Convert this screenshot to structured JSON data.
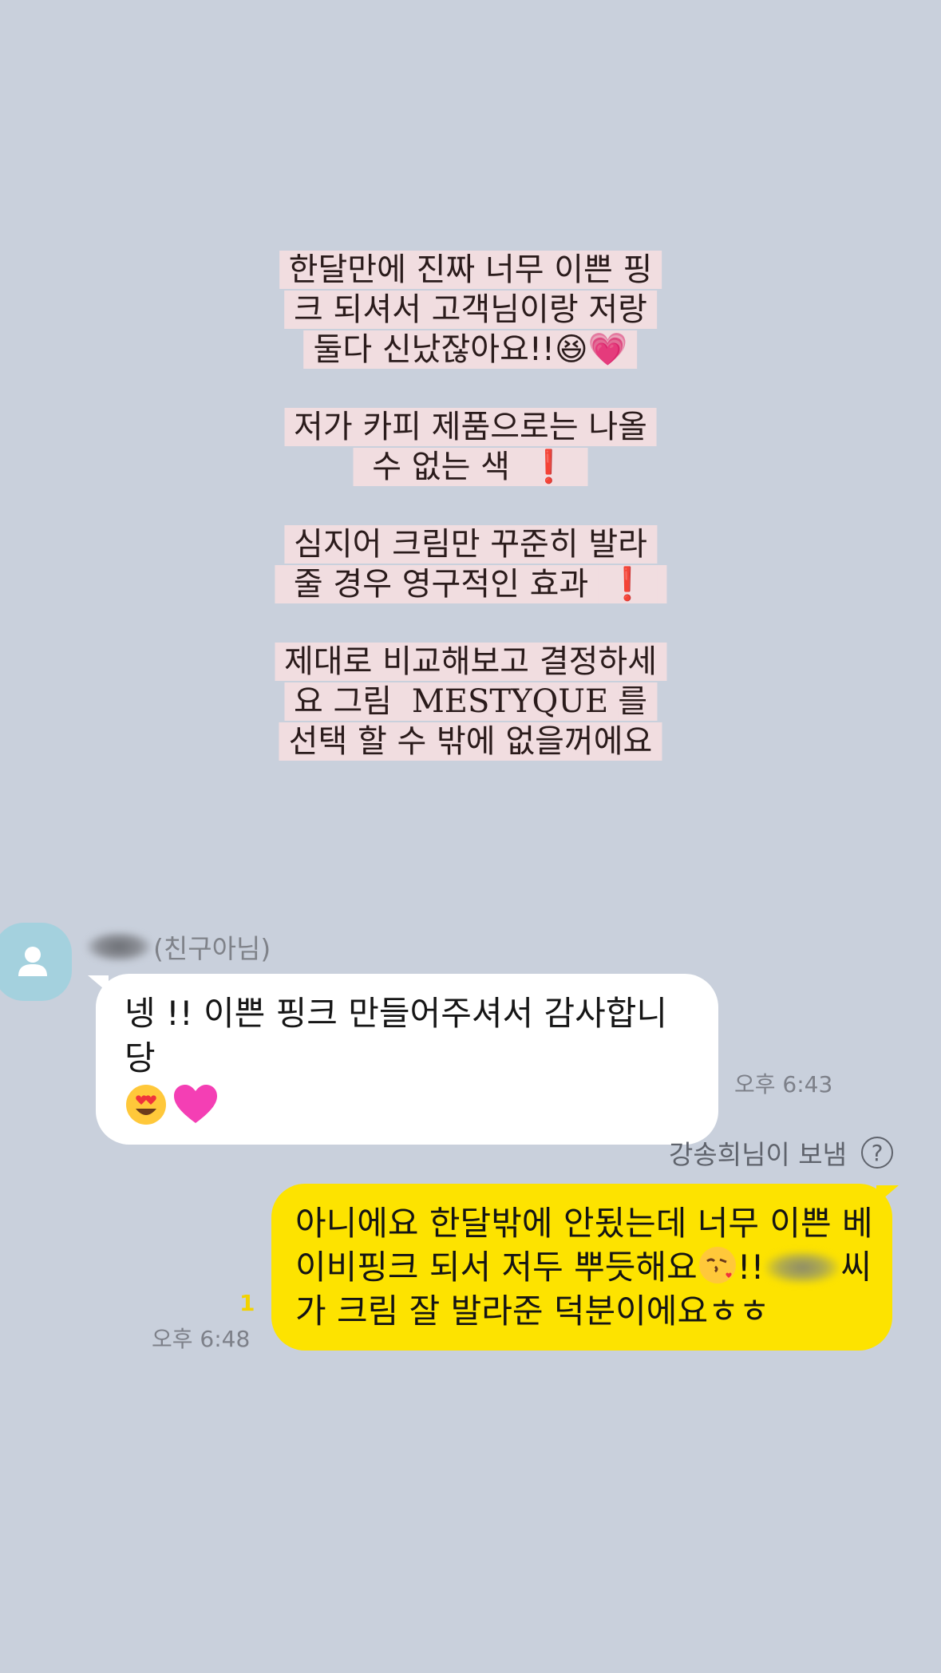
{
  "captions": [
    {
      "lines": [
        "한달만에 진짜 너무 이쁜 핑",
        "크 되셔서 고객님이랑 저랑",
        "둘다 신났잖아요!!😆💗"
      ]
    },
    {
      "lines": [
        "저가 카피 제품으로는 나올",
        "수 없는 색"
      ],
      "mark": "❗"
    },
    {
      "lines": [
        "심지어 크림만 꾸준히 발라",
        "줄 경우 영구적인 효과"
      ],
      "mark": "❗"
    },
    {
      "lines": [
        "제대로 비교해보고 결정하세",
        "요 그림 MESTYQUE를",
        "선택 할 수 밖에 없을꺼에요"
      ]
    }
  ],
  "incoming": {
    "sender_suffix": "(친구아님)",
    "text_line1": "넹 !! 이쁜 핑크 만들어주셔서 감사합니당",
    "time": "오후 6:43",
    "icons": [
      "heart-eyes-emoji",
      "pink-heart-emoji"
    ]
  },
  "outgoing": {
    "sent_by": "강송희님이 보냄",
    "help_symbol": "?",
    "text_line1": "아니에요 한달밖에 안됬는데 너무 이쁜 베",
    "text_line2_a": "이비핑크 되서 저두 뿌듯해요",
    "text_line2_b": "!!",
    "text_line2_c": "씨",
    "text_line3": "가 크림 잘 발라준 덕분이에요ㅎㅎ",
    "unread_count": "1",
    "time": "오후 6:48",
    "colors": {
      "bubble": "#fde300",
      "unread": "#f2d200"
    }
  },
  "colors": {
    "background": "#c9d0dc",
    "caption_bg": "#f1dde0",
    "avatar": "#a4d1de"
  }
}
